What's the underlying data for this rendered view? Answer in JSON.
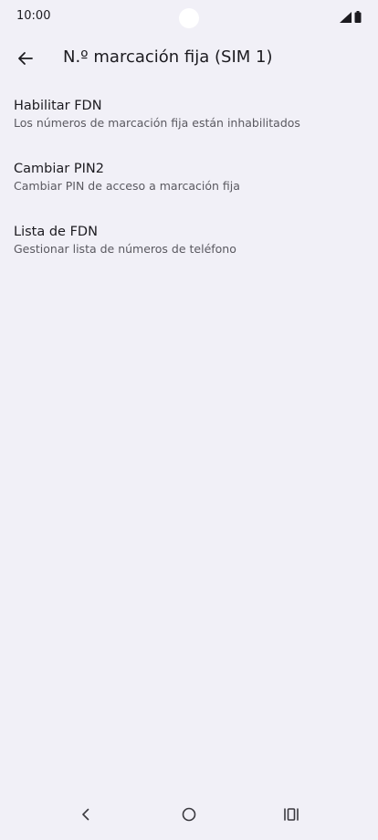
{
  "status_bar": {
    "time": "10:00",
    "icons": [
      "signal-icon",
      "battery-icon"
    ]
  },
  "app_bar": {
    "back_icon": "arrow-left-icon",
    "title": "N.º marcación fija (SIM 1)"
  },
  "settings": [
    {
      "title": "Habilitar FDN",
      "summary": "Los números de marcación fija están inhabilitados"
    },
    {
      "title": "Cambiar PIN2",
      "summary": "Cambiar PIN de acceso a marcación fija"
    },
    {
      "title": "Lista de FDN",
      "summary": "Gestionar lista de números de teléfono"
    }
  ],
  "nav_bar": {
    "icons": [
      "nav-back-icon",
      "nav-home-icon",
      "nav-recents-icon"
    ]
  },
  "colors": {
    "background": "#f1f0f7",
    "text_primary": "#1c1b20",
    "text_secondary": "#5a5960"
  }
}
